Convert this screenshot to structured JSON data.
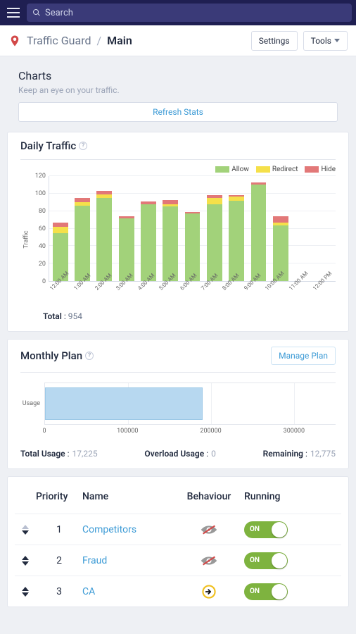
{
  "search": {
    "placeholder": "Search"
  },
  "breadcrumb": {
    "app": "Traffic Guard",
    "current": "Main",
    "settings": "Settings",
    "tools": "Tools"
  },
  "section": {
    "title": "Charts",
    "subtitle": "Keep an eye on your traffic.",
    "refresh": "Refresh Stats"
  },
  "daily": {
    "title": "Daily Traffic",
    "ylabel": "Traffic",
    "total_label": "Total",
    "total_value": "954"
  },
  "monthly": {
    "title": "Monthly Plan",
    "manage": "Manage Plan",
    "ylabel": "Usage",
    "total_label": "Total Usage",
    "total_value": "17,225",
    "overload_label": "Overload Usage",
    "overload_value": "0",
    "remaining_label": "Remaining",
    "remaining_value": "12,775"
  },
  "table": {
    "headers": {
      "priority": "Priority",
      "name": "Name",
      "behaviour": "Behaviour",
      "running": "Running"
    },
    "toggle_on": "ON",
    "rows": [
      {
        "priority": "1",
        "name": "Competitors",
        "behaviour": "hide-slash",
        "running": true,
        "sort_up": false,
        "sort_dn": true
      },
      {
        "priority": "2",
        "name": "Fraud",
        "behaviour": "hide-slash",
        "running": true,
        "sort_up": true,
        "sort_dn": true
      },
      {
        "priority": "3",
        "name": "CA",
        "behaviour": "redirect",
        "running": true,
        "sort_up": true,
        "sort_dn": true
      }
    ]
  },
  "chart_data": [
    {
      "type": "bar",
      "title": "Daily Traffic",
      "ylabel": "Traffic",
      "xlabel": "",
      "ylim": [
        0,
        120
      ],
      "categories": [
        "12:00 AM",
        "1:00 AM",
        "2:00 AM",
        "3:00 AM",
        "4:00 AM",
        "5:00 AM",
        "6:00 AM",
        "7:00 AM",
        "8:00 AM",
        "9:00 AM",
        "10:00 AM",
        "11:00 AM",
        "12:00 PM"
      ],
      "legend": [
        "Allow",
        "Redirect",
        "Hide"
      ],
      "series": [
        {
          "name": "Allow",
          "values": [
            55,
            86,
            95,
            72,
            88,
            85,
            77,
            88,
            92,
            110,
            64,
            0,
            0
          ]
        },
        {
          "name": "Redirect",
          "values": [
            7,
            4,
            4,
            0,
            0,
            3,
            0,
            7,
            5,
            0,
            3,
            0,
            0
          ]
        },
        {
          "name": "Hide",
          "values": [
            5,
            5,
            4,
            2,
            3,
            5,
            2,
            3,
            1,
            3,
            7,
            0,
            0
          ]
        }
      ],
      "total": 954,
      "legend_position": "top-right",
      "grid": true
    },
    {
      "type": "bar",
      "orientation": "horizontal",
      "title": "Monthly Plan",
      "ylabel": "",
      "xlabel": "",
      "xlim": [
        0,
        350000
      ],
      "categories": [
        "Usage"
      ],
      "xticks": [
        0,
        100000,
        200000,
        300000
      ],
      "series": [
        {
          "name": "Usage",
          "values": [
            190000
          ]
        }
      ],
      "grid": true
    }
  ]
}
